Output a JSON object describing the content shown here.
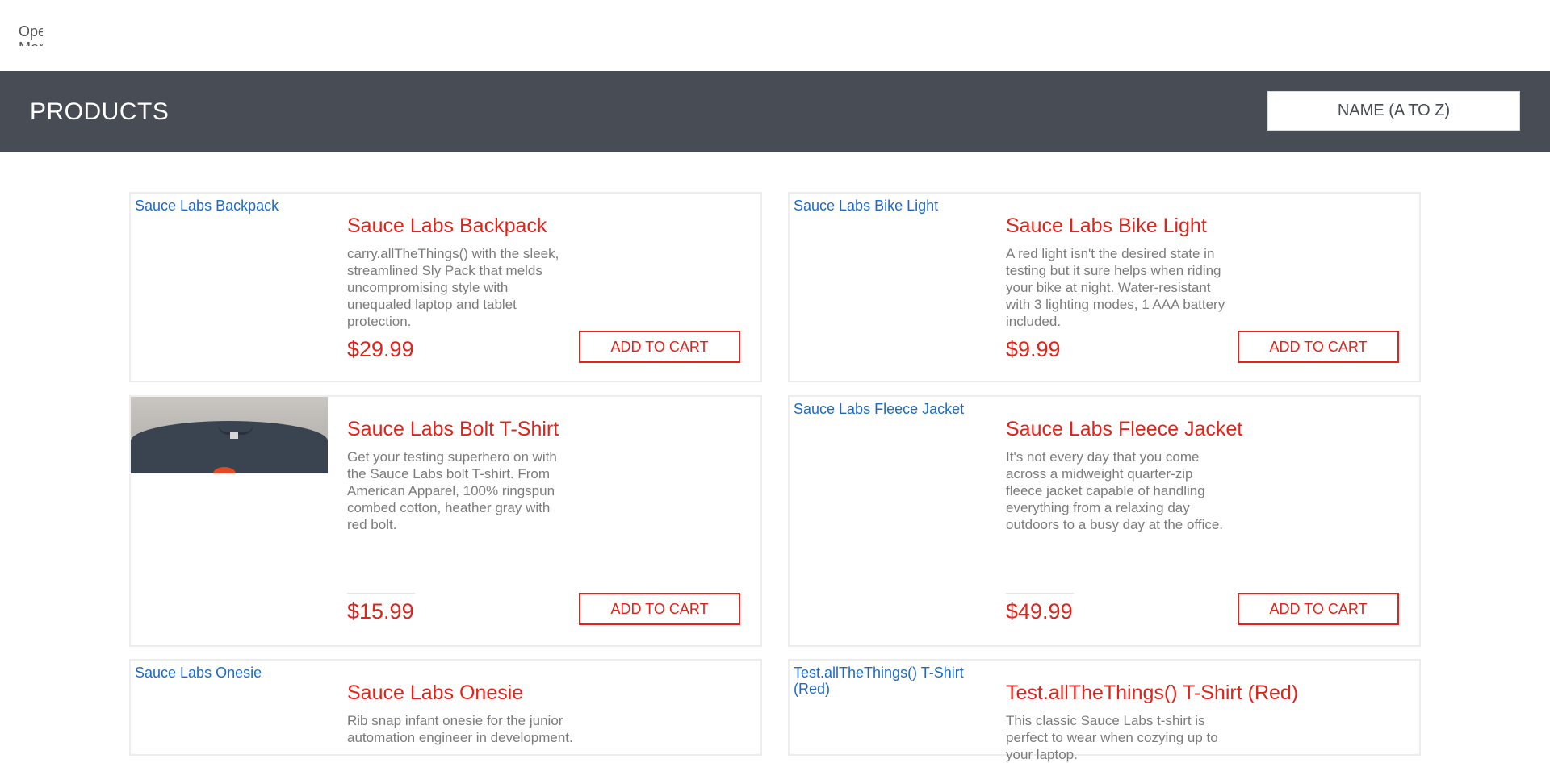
{
  "topbar": {
    "menu_text": "Open Menu"
  },
  "header": {
    "title": "PRODUCTS",
    "sort_selected": "NAME (A TO Z)"
  },
  "products": [
    {
      "image_alt": "Sauce Labs Backpack",
      "name": "Sauce Labs Backpack",
      "description": "carry.allTheThings() with the sleek, streamlined Sly Pack that melds uncompromising style with unequaled laptop and tablet protection.",
      "price": "$29.99",
      "button": "ADD TO CART"
    },
    {
      "image_alt": "Sauce Labs Bike Light",
      "name": "Sauce Labs Bike Light",
      "description": "A red light isn't the desired state in testing but it sure helps when riding your bike at night. Water-resistant with 3 lighting modes, 1 AAA battery included.",
      "price": "$9.99",
      "button": "ADD TO CART"
    },
    {
      "image_alt": "",
      "name": "Sauce Labs Bolt T-Shirt",
      "description": "Get your testing superhero on with the Sauce Labs bolt T-shirt. From American Apparel, 100% ringspun combed cotton, heather gray with red bolt.",
      "price": "$15.99",
      "button": "ADD TO CART"
    },
    {
      "image_alt": "Sauce Labs Fleece Jacket",
      "name": "Sauce Labs Fleece Jacket",
      "description": "It's not every day that you come across a midweight quarter-zip fleece jacket capable of handling everything from a relaxing day outdoors to a busy day at the office.",
      "price": "$49.99",
      "button": "ADD TO CART"
    },
    {
      "image_alt": "Sauce Labs Onesie",
      "name": "Sauce Labs Onesie",
      "description": "Rib snap infant onesie for the junior automation engineer in development.",
      "price": "",
      "button": ""
    },
    {
      "image_alt": "Test.allTheThings() T-Shirt (Red)",
      "name": "Test.allTheThings() T-Shirt (Red)",
      "description": "This classic Sauce Labs t-shirt is perfect to wear when cozying up to your laptop.",
      "price": "",
      "button": ""
    }
  ]
}
